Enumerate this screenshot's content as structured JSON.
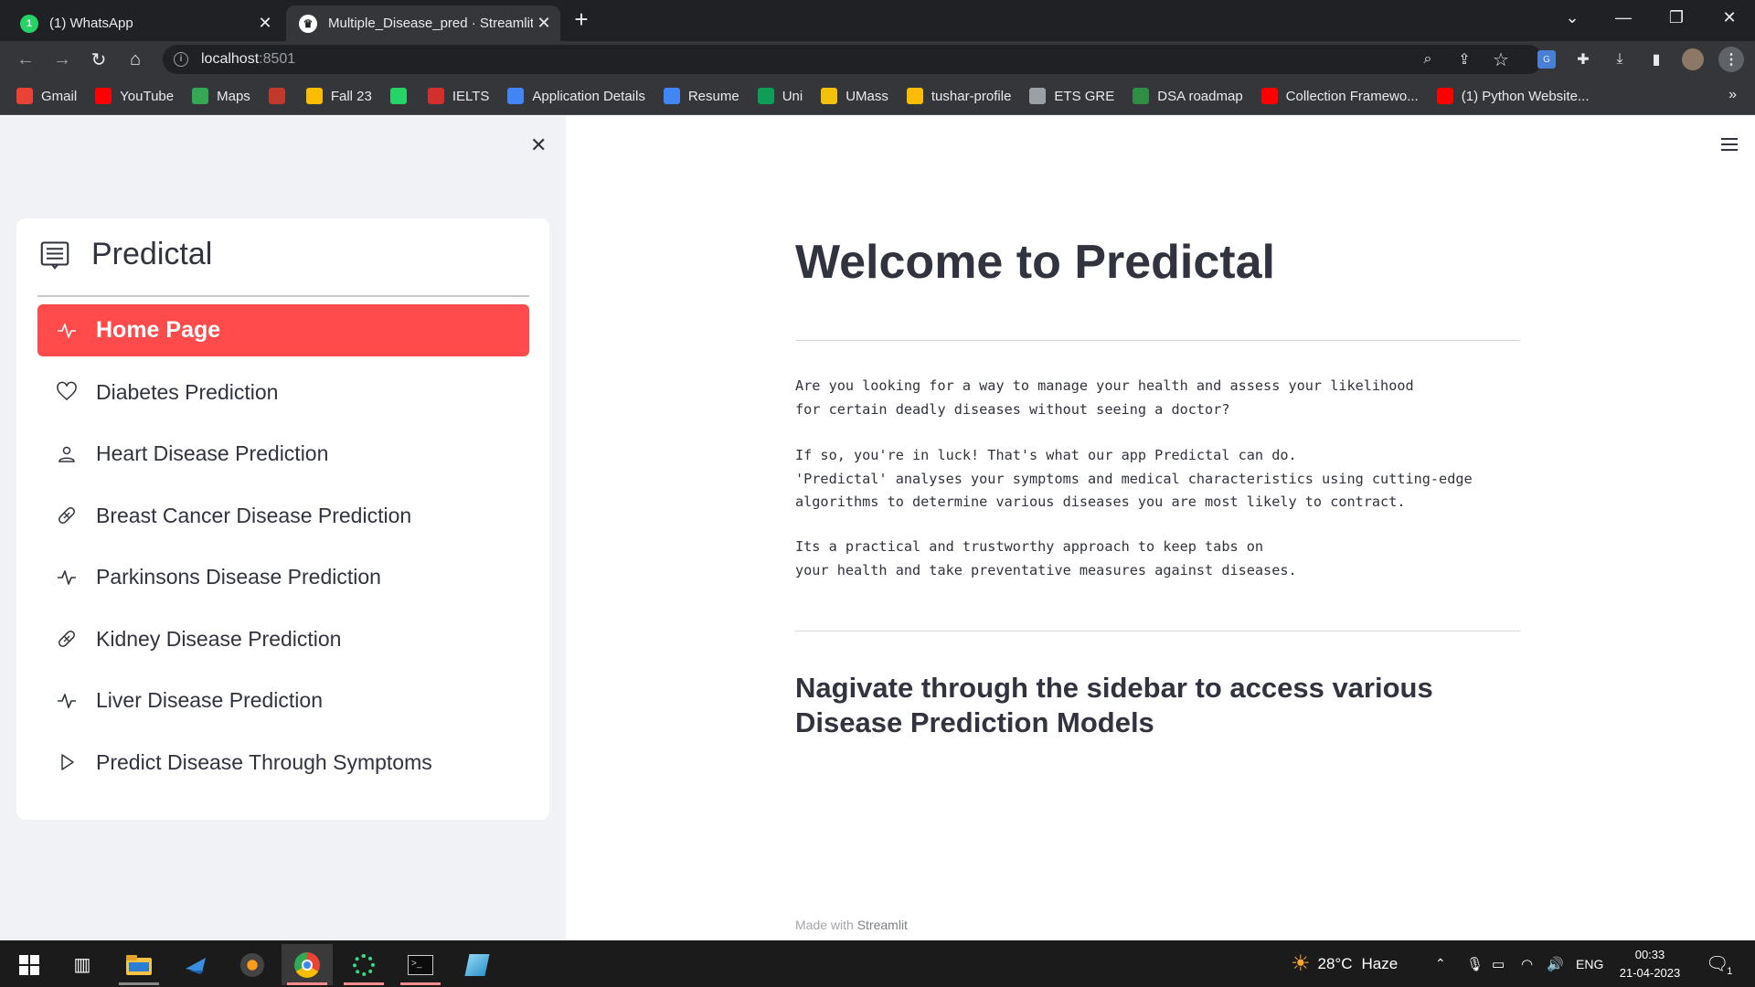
{
  "browser": {
    "tabs": [
      {
        "title": "(1) WhatsApp",
        "favicon": "whatsapp-icon",
        "active": false
      },
      {
        "title": "Multiple_Disease_pred · Streamlit",
        "favicon": "streamlit-icon",
        "active": true
      }
    ],
    "url_host": "localhost",
    "url_port": ":8501",
    "bookmarks": [
      {
        "label": "Gmail",
        "icon": "gmail-icon",
        "color": "#ea4335"
      },
      {
        "label": "YouTube",
        "icon": "youtube-icon",
        "color": "#ff0000"
      },
      {
        "label": "Maps",
        "icon": "maps-icon",
        "color": "#34a853"
      },
      {
        "label": "",
        "icon": "pp-icon",
        "color": "#c0392b"
      },
      {
        "label": "Fall 23",
        "icon": "drive-icon",
        "color": "#fbbc04"
      },
      {
        "label": "",
        "icon": "whatsapp-icon",
        "color": "#25d366"
      },
      {
        "label": "IELTS",
        "icon": "ielts-icon",
        "color": "#d32f2f"
      },
      {
        "label": "Application Details",
        "icon": "docs-icon",
        "color": "#4285f4"
      },
      {
        "label": "Resume",
        "icon": "docs-icon",
        "color": "#4285f4"
      },
      {
        "label": "Uni",
        "icon": "sheets-icon",
        "color": "#0f9d58"
      },
      {
        "label": "UMass",
        "icon": "keep-icon",
        "color": "#f4c20d"
      },
      {
        "label": "tushar-profile",
        "icon": "drive-icon",
        "color": "#fbbc04"
      },
      {
        "label": "ETS GRE",
        "icon": "globe-icon",
        "color": "#9aa0a6"
      },
      {
        "label": "DSA roadmap",
        "icon": "gfg-icon",
        "color": "#2f8d46"
      },
      {
        "label": "Collection Framewo...",
        "icon": "youtube-icon",
        "color": "#ff0000"
      },
      {
        "label": "(1) Python Website...",
        "icon": "youtube-icon",
        "color": "#ff0000"
      }
    ]
  },
  "sidebar": {
    "menu_title": "Predictal",
    "items": [
      {
        "label": "Home Page",
        "icon": "activity-icon",
        "active": true
      },
      {
        "label": "Diabetes Prediction",
        "icon": "heart-icon",
        "active": false
      },
      {
        "label": "Heart Disease Prediction",
        "icon": "person-icon",
        "active": false
      },
      {
        "label": "Breast Cancer Disease Prediction",
        "icon": "bandaid-icon",
        "active": false
      },
      {
        "label": "Parkinsons Disease Prediction",
        "icon": "activity-icon",
        "active": false
      },
      {
        "label": "Kidney Disease Prediction",
        "icon": "bandaid-icon",
        "active": false
      },
      {
        "label": "Liver Disease Prediction",
        "icon": "activity-icon",
        "active": false
      },
      {
        "label": "Predict Disease Through Symptoms",
        "icon": "play-icon",
        "active": false
      }
    ],
    "accent_color": "#ff4b4b"
  },
  "main": {
    "title": "Welcome to Predictal",
    "para1": "Are you looking for a way to manage your health and assess your likelihood\nfor certain deadly diseases without seeing a doctor?",
    "para2": "If so, you're in luck! That's what our app Predictal can do.\n'Predictal' analyses your symptoms and medical characteristics using cutting-edge\nalgorithms to determine various diseases you are most likely to contract.",
    "para3": "Its a practical and trustworthy approach to keep tabs on\nyour health and take preventative measures against diseases.",
    "subheading": "Nagivate through the sidebar to access various Disease Prediction Models",
    "footer_prefix": "Made with",
    "footer_brand": "Streamlit"
  },
  "taskbar": {
    "weather_temp": "28°C",
    "weather_desc": "Haze",
    "language": "ENG",
    "time": "00:33",
    "date": "21-04-2023",
    "notification_count": "1"
  }
}
